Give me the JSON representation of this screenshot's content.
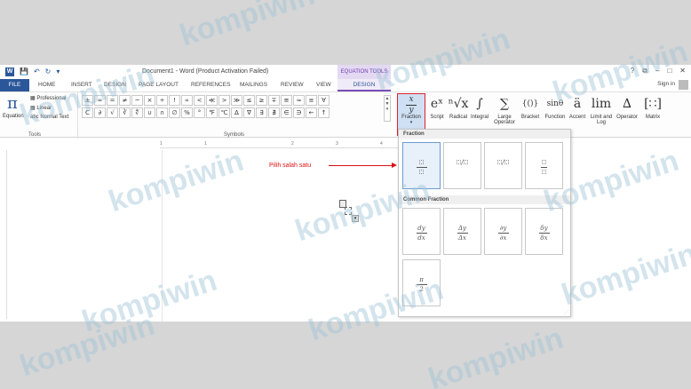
{
  "title_bar": {
    "document_title": "Document1 - Word (Product Activation Failed)",
    "contextual_tab_group": "EQUATION TOOLS",
    "help": "?",
    "restore": "⧉",
    "minimize": "–",
    "maximize": "□",
    "close": "✕"
  },
  "tabs": [
    "FILE",
    "HOME",
    "INSERT",
    "DESIGN",
    "PAGE LAYOUT",
    "REFERENCES",
    "MAILINGS",
    "REVIEW",
    "VIEW",
    "DESIGN"
  ],
  "sign_in": "Sign in",
  "tools_group": {
    "equation_label": "Equation",
    "professional": "Professional",
    "linear": "Linear",
    "normal_text": "Normal Text",
    "group_label": "Tools"
  },
  "symbols_group": {
    "row1": [
      "±",
      "∞",
      "=",
      "≠",
      "~",
      "×",
      "÷",
      "!",
      "∝",
      "<",
      "≪",
      ">",
      "≫",
      "≤",
      "≥",
      "∓",
      "≅",
      "≈",
      "≡",
      "∀"
    ],
    "row2": [
      "C",
      "∂",
      "√",
      "∛",
      "∜",
      "∪",
      "∩",
      "∅",
      "%",
      "°",
      "℉",
      "℃",
      "∆",
      "∇",
      "∃",
      "∄",
      "∈",
      "∋",
      "←",
      "↑"
    ],
    "group_label": "Symbols"
  },
  "structures": [
    {
      "label": "Fraction",
      "glyph": ""
    },
    {
      "label": "Script",
      "glyph": "eˣ"
    },
    {
      "label": "Radical",
      "glyph": "ⁿ√x"
    },
    {
      "label": "Integral",
      "glyph": "∫"
    },
    {
      "label": "Large Operator",
      "glyph": "∑"
    },
    {
      "label": "Bracket",
      "glyph": "{()}"
    },
    {
      "label": "Function",
      "glyph": "sinθ"
    },
    {
      "label": "Accent",
      "glyph": "ä"
    },
    {
      "label": "Limit and Log",
      "glyph": "lim"
    },
    {
      "label": "Operator",
      "glyph": "∆"
    },
    {
      "label": "Matrix",
      "glyph": "[∷]"
    }
  ],
  "fraction_glyph": {
    "numerator": "x",
    "denominator": "y"
  },
  "annotation": "Pilih salah satu",
  "gallery": {
    "section1": "Fraction",
    "section2": "Common Fraction",
    "common": [
      {
        "num": "dy",
        "den": "dx"
      },
      {
        "num": "Δy",
        "den": "Δx"
      },
      {
        "num": "∂y",
        "den": "∂x"
      },
      {
        "num": "δy",
        "den": "δx"
      },
      {
        "num": "π",
        "den": "2"
      }
    ]
  },
  "ruler": {
    "marks": [
      "1",
      "1",
      "2",
      "3",
      "4"
    ]
  },
  "watermark": "kompiwin",
  "colors": {
    "word_blue": "#2b579a",
    "equation_tools": "#7a4fb8",
    "annotation_red": "#dd1111",
    "highlight_border": "#e0202a"
  }
}
